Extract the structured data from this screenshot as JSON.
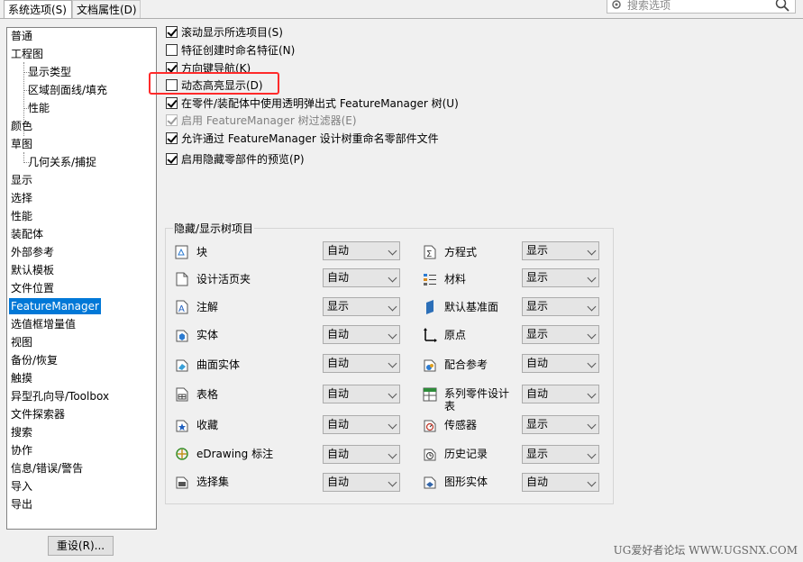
{
  "tabs": {
    "system_options": "系统选项(S)",
    "document_properties": "文档属性(D)"
  },
  "search": {
    "placeholder": "搜索选项"
  },
  "tree": {
    "items": [
      {
        "label": "普通",
        "level": 0
      },
      {
        "label": "工程图",
        "level": 0
      },
      {
        "label": "显示类型",
        "level": 1
      },
      {
        "label": "区域剖面线/填充",
        "level": 1
      },
      {
        "label": "性能",
        "level": 1
      },
      {
        "label": "颜色",
        "level": 0
      },
      {
        "label": "草图",
        "level": 0
      },
      {
        "label": "几何关系/捕捉",
        "level": 1
      },
      {
        "label": "显示",
        "level": 0
      },
      {
        "label": "选择",
        "level": 0
      },
      {
        "label": "性能",
        "level": 0
      },
      {
        "label": "装配体",
        "level": 0
      },
      {
        "label": "外部参考",
        "level": 0
      },
      {
        "label": "默认模板",
        "level": 0
      },
      {
        "label": "文件位置",
        "level": 0
      },
      {
        "label": "FeatureManager",
        "level": 0,
        "selected": true
      },
      {
        "label": "选值框增量值",
        "level": 0
      },
      {
        "label": "视图",
        "level": 0
      },
      {
        "label": "备份/恢复",
        "level": 0
      },
      {
        "label": "触摸",
        "level": 0
      },
      {
        "label": "异型孔向导/Toolbox",
        "level": 0
      },
      {
        "label": "文件探索器",
        "level": 0
      },
      {
        "label": "搜索",
        "level": 0
      },
      {
        "label": "协作",
        "level": 0
      },
      {
        "label": "信息/错误/警告",
        "level": 0
      },
      {
        "label": "导入",
        "level": 0
      },
      {
        "label": "导出",
        "level": 0
      }
    ]
  },
  "reset_button": "重设(R)...",
  "checkboxes": [
    {
      "label": "滚动显示所选项目(S)",
      "checked": true,
      "enabled": true
    },
    {
      "label": "特征创建时命名特征(N)",
      "checked": false,
      "enabled": true
    },
    {
      "label": "方向键导航(K)",
      "checked": true,
      "enabled": true
    },
    {
      "label": "动态高亮显示(D)",
      "checked": false,
      "enabled": true
    },
    {
      "label": "在零件/装配体中使用透明弹出式 FeatureManager 树(U)",
      "checked": true,
      "enabled": true
    },
    {
      "label": "启用 FeatureManager 树过滤器(E)",
      "checked": true,
      "enabled": false
    },
    {
      "label": "允许通过 FeatureManager 设计树重命名零部件文件",
      "checked": true,
      "enabled": true
    },
    {
      "label": "启用隐藏零部件的预览(P)",
      "checked": true,
      "enabled": true
    }
  ],
  "group": {
    "title": "隐藏/显示树项目",
    "left": [
      {
        "icon": "block-icon",
        "label": "块",
        "value": "自动"
      },
      {
        "icon": "design-binder-icon",
        "label": "设计活页夹",
        "value": "自动"
      },
      {
        "icon": "annotation-icon",
        "label": "注解",
        "value": "显示"
      },
      {
        "icon": "solid-body-icon",
        "label": "实体",
        "value": "自动"
      },
      {
        "icon": "surface-body-icon",
        "label": "曲面实体",
        "value": "自动"
      },
      {
        "icon": "table-icon",
        "label": "表格",
        "value": "自动"
      },
      {
        "icon": "favorites-icon",
        "label": "收藏",
        "value": "自动"
      },
      {
        "icon": "edrawing-icon",
        "label": "eDrawing 标注",
        "value": "自动"
      },
      {
        "icon": "selection-set-icon",
        "label": "选择集",
        "value": "自动"
      }
    ],
    "right": [
      {
        "icon": "equation-icon",
        "label": "方程式",
        "value": "显示"
      },
      {
        "icon": "material-icon",
        "label": "材料",
        "value": "显示"
      },
      {
        "icon": "default-plane-icon",
        "label": "默认基准面",
        "value": "显示"
      },
      {
        "icon": "origin-icon",
        "label": "原点",
        "value": "显示"
      },
      {
        "icon": "mate-reference-icon",
        "label": "配合参考",
        "value": "自动"
      },
      {
        "icon": "design-table-icon",
        "label": "系列零件设计表",
        "value": "自动"
      },
      {
        "icon": "sensor-icon",
        "label": "传感器",
        "value": "显示"
      },
      {
        "icon": "history-icon",
        "label": "历史记录",
        "value": "显示"
      },
      {
        "icon": "graphics-body-icon",
        "label": "图形实体",
        "value": "自动"
      }
    ]
  },
  "watermark": "UG爱好者论坛 WWW.UGSNX.COM",
  "colors": {
    "selection": "#0078d7",
    "highlight_box": "#ff2a2a"
  }
}
